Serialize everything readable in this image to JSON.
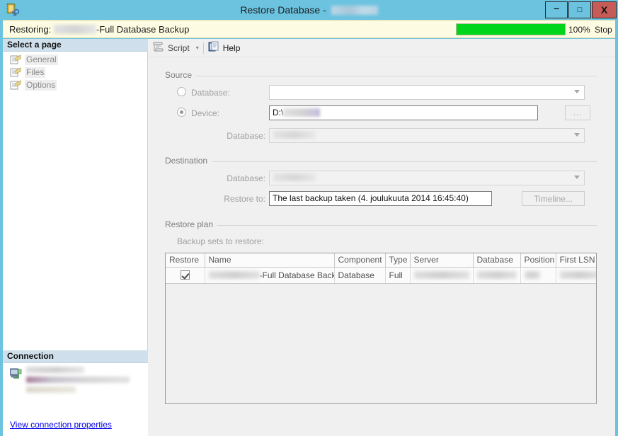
{
  "window": {
    "title_prefix": "Restore Database - ",
    "title_server_redacted": "",
    "icon": "restore-database-icon",
    "buttons": {
      "minimize": "–",
      "maximize": "□",
      "close": "X"
    },
    "colors": {
      "titlebar": "#6cc3e0",
      "close_button": "#c75b57",
      "progress_green": "#00d41b",
      "progress_strip": "#fdfce2",
      "pane_header": "#cfdfeb",
      "link": "#0000ee"
    }
  },
  "progress": {
    "label_prefix": "Restoring: ",
    "label_suffix": "-Full Database Backup",
    "percent_text": "100%",
    "percent_value": 100,
    "stop_label": "Stop"
  },
  "sidebar": {
    "select_page_header": "Select a page",
    "items": [
      {
        "label": "General",
        "icon": "page-icon"
      },
      {
        "label": "Files",
        "icon": "page-icon"
      },
      {
        "label": "Options",
        "icon": "page-icon"
      }
    ],
    "connection_header": "Connection",
    "connection_icon": "server-connection-icon",
    "view_connection_properties": "View connection properties"
  },
  "toolbar": {
    "script_label": "Script",
    "script_icon": "script-icon",
    "script_dropdown_caret": "▾",
    "help_label": "Help",
    "help_icon": "help-icon"
  },
  "source": {
    "group_title": "Source",
    "database_radio_label": "Database:",
    "database_radio_selected": false,
    "database_combo_value": "",
    "device_radio_label": "Device:",
    "device_radio_selected": true,
    "device_path_value": "D:\\",
    "browse_button_label": "...",
    "device_database_label": "Database:",
    "device_database_value": ""
  },
  "destination": {
    "group_title": "Destination",
    "database_label": "Database:",
    "database_value": "",
    "restore_to_label": "Restore to:",
    "restore_to_value": "The last backup taken (4. joulukuuta 2014 16:45:40)",
    "timeline_button_label": "Timeline..."
  },
  "restore_plan": {
    "group_title": "Restore plan",
    "backup_sets_label": "Backup sets to restore:",
    "columns": [
      "Restore",
      "Name",
      "Component",
      "Type",
      "Server",
      "Database",
      "Position",
      "First LSN"
    ],
    "rows": [
      {
        "restore_checked": true,
        "name": "-Full Database Backup",
        "component": "Database",
        "type": "Full",
        "server": "",
        "database": "",
        "position": "",
        "first_lsn": ""
      }
    ]
  }
}
